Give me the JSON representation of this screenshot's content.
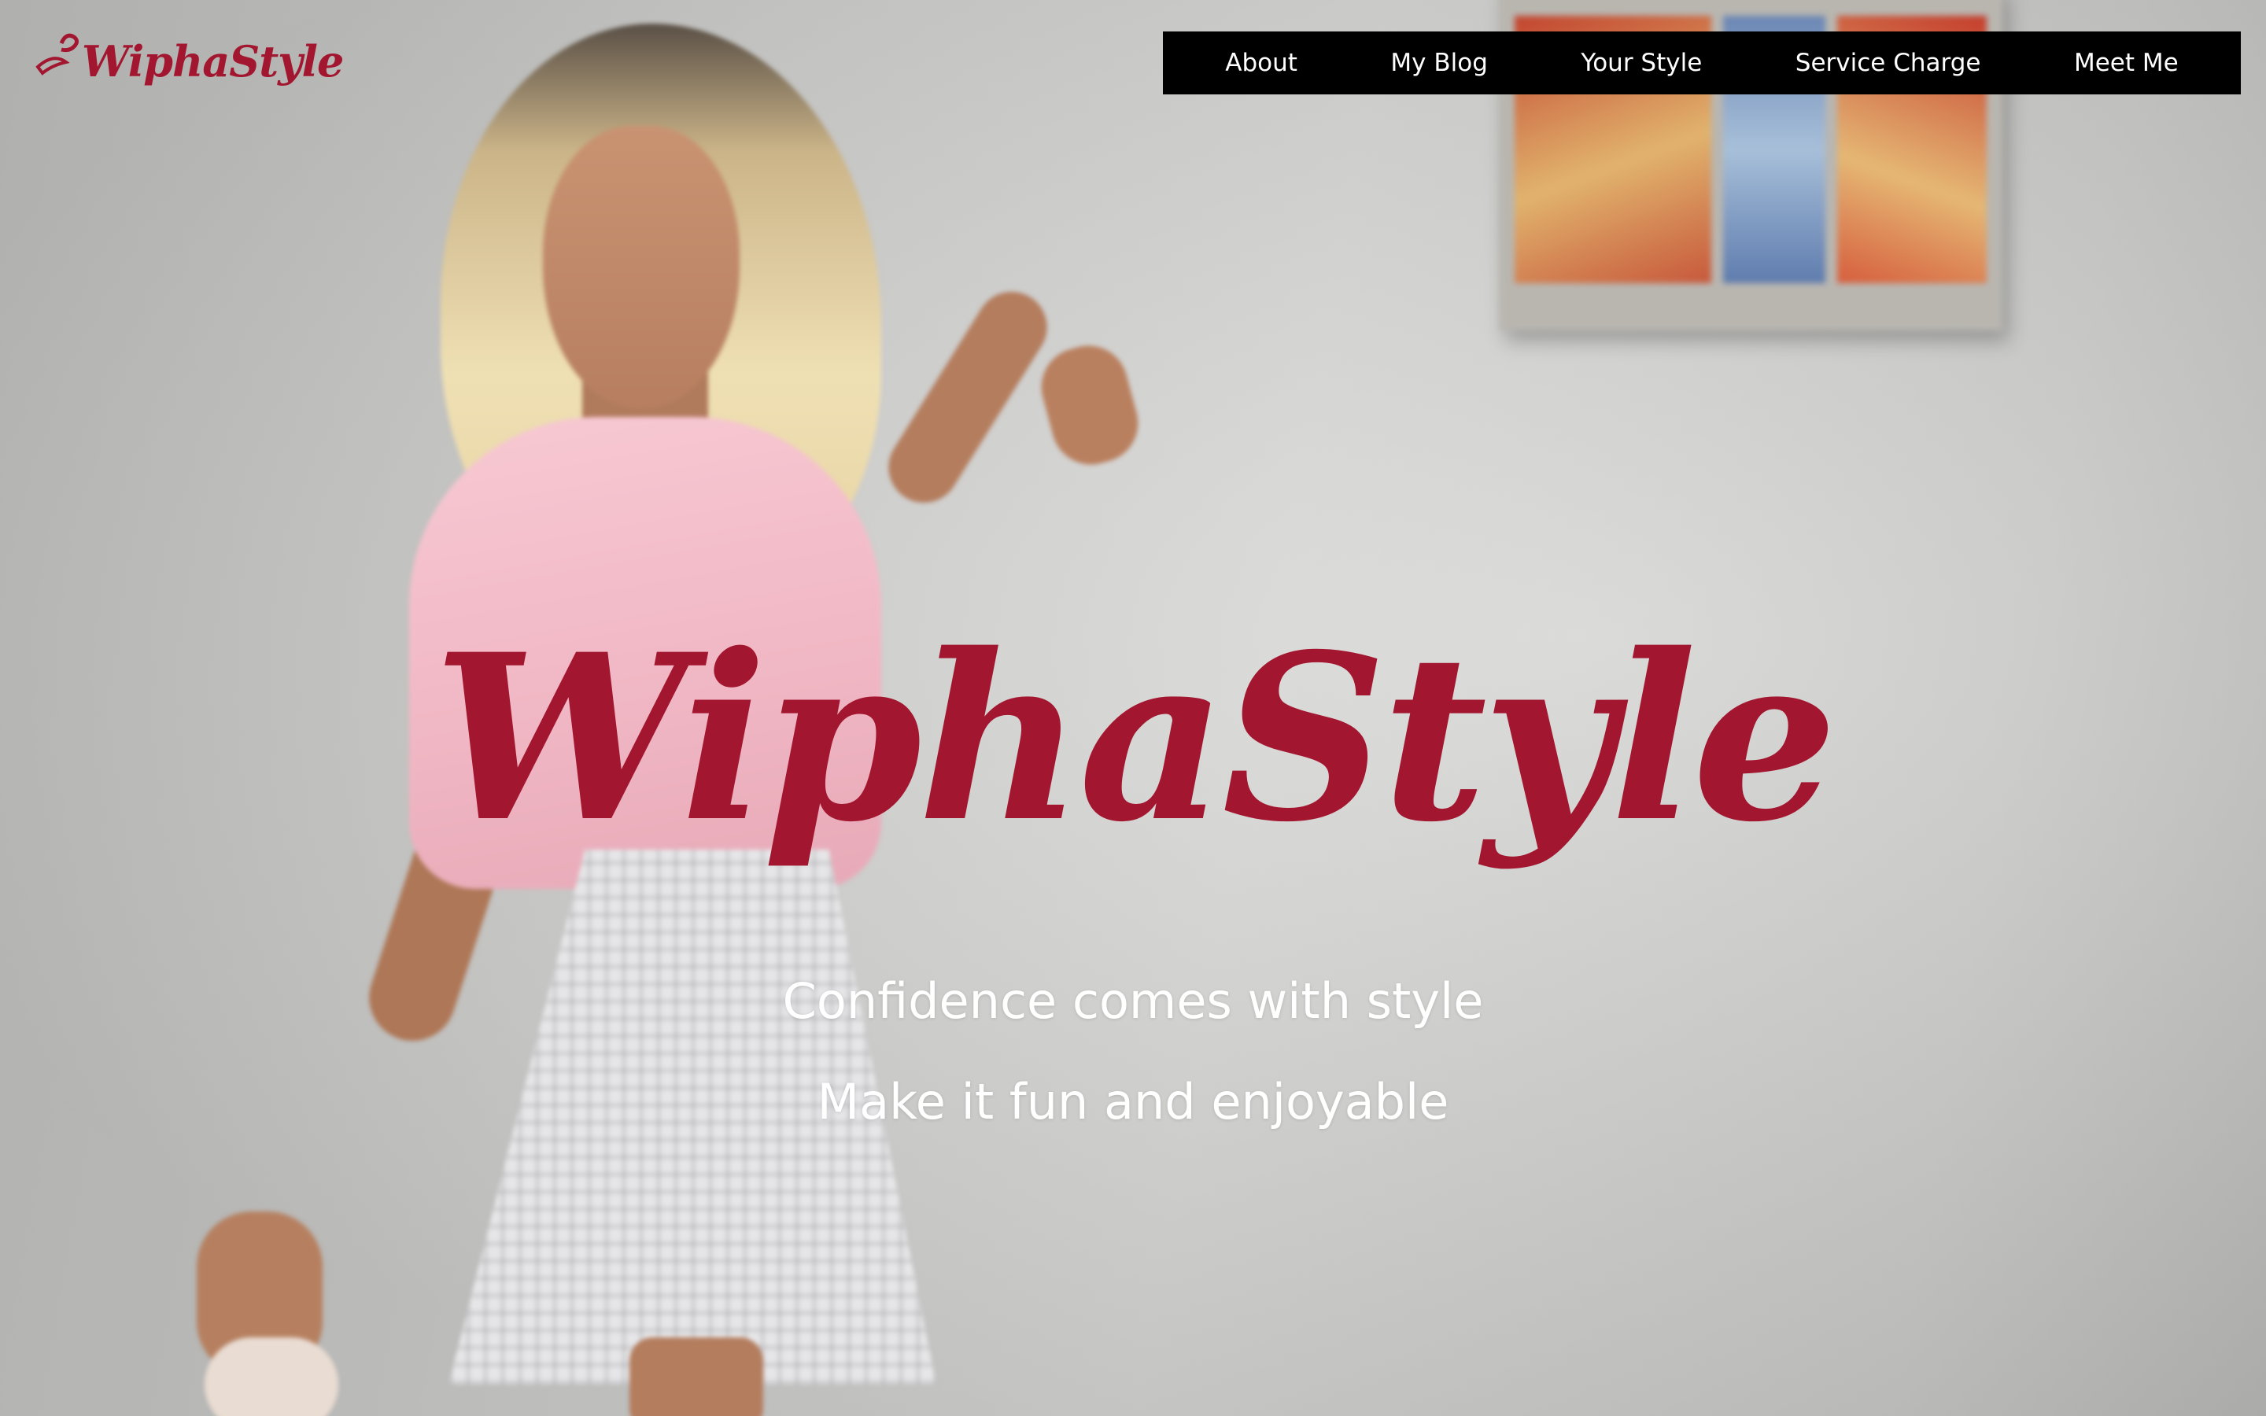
{
  "brand": {
    "logo_text": "WiphaStyle",
    "accent_color": "#a3162f"
  },
  "nav": {
    "items": [
      {
        "label": "About"
      },
      {
        "label": "My Blog"
      },
      {
        "label": "Your Style"
      },
      {
        "label": "Service Charge"
      },
      {
        "label": "Meet Me"
      }
    ],
    "background_color": "#000000",
    "text_color": "#ffffff"
  },
  "hero": {
    "title": "WiphaStyle",
    "taglines": [
      "Confidence comes with style",
      "Make it fun and enjoyable"
    ],
    "tagline_color": "#ffffff"
  },
  "background": {
    "subject": "photo-background"
  }
}
